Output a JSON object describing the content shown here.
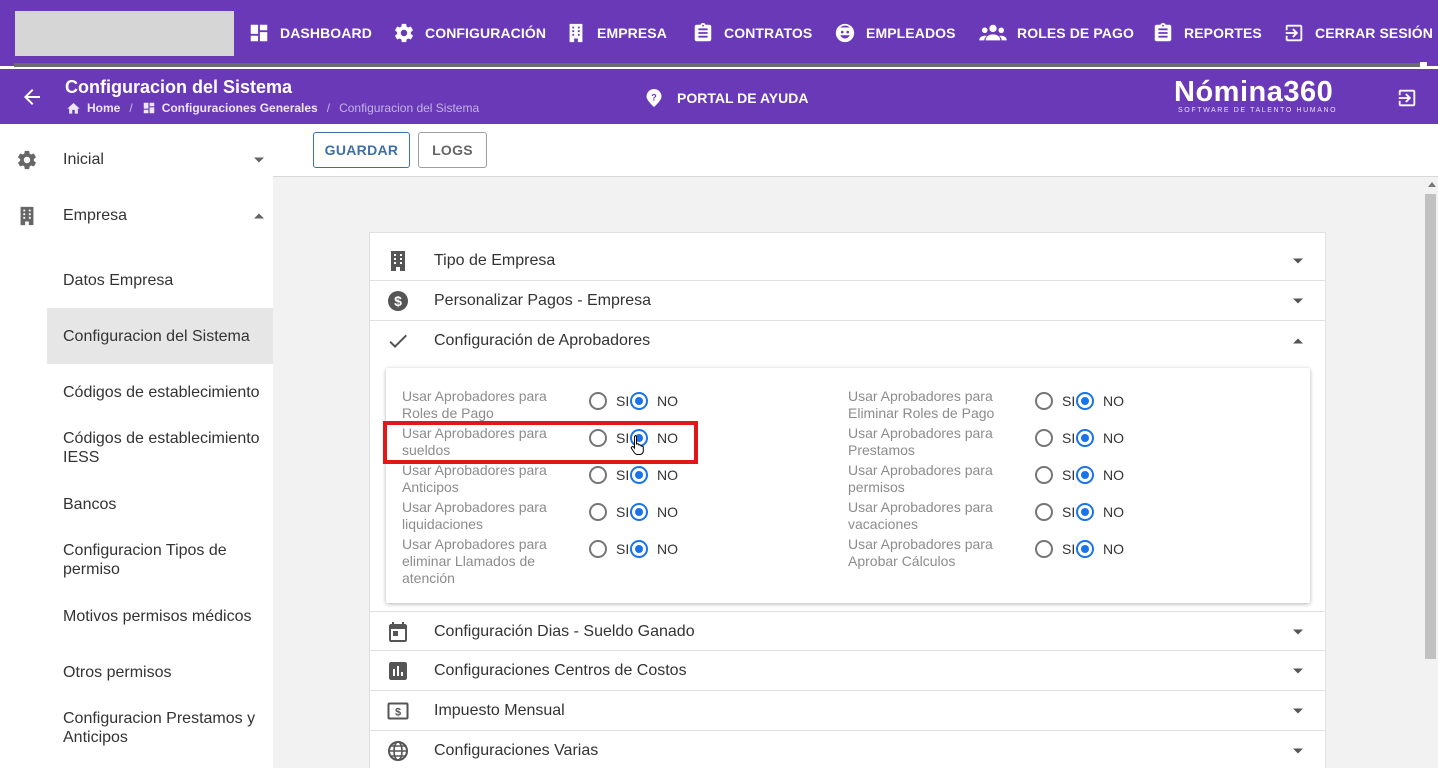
{
  "topnav": {
    "items": [
      {
        "label": "DASHBOARD",
        "icon": "dashboard-icon"
      },
      {
        "label": "CONFIGURACIÓN",
        "icon": "gear-icon"
      },
      {
        "label": "EMPRESA",
        "icon": "building-icon"
      },
      {
        "label": "CONTRATOS",
        "icon": "clipboard-icon"
      },
      {
        "label": "EMPLEADOS",
        "icon": "face-icon"
      },
      {
        "label": "ROLES DE PAGO",
        "icon": "people-icon"
      },
      {
        "label": "REPORTES",
        "icon": "clipboard-list-icon"
      },
      {
        "label": "CERRAR SESIÓN",
        "icon": "logout-icon"
      }
    ],
    "accent_color": "#6a39b8"
  },
  "header": {
    "title": "Configuracion del Sistema",
    "breadcrumb": {
      "home": "Home",
      "section": "Configuraciones Generales",
      "current": "Configuracion del Sistema",
      "separator": "/"
    },
    "help": "PORTAL DE AYUDA",
    "brand_name": "Nómina360",
    "brand_tagline": "SOFTWARE DE TALENTO HUMANO"
  },
  "sidebar": {
    "groups": [
      {
        "label": "Inicial",
        "icon": "gear-icon",
        "expanded": false
      },
      {
        "label": "Empresa",
        "icon": "building-icon",
        "expanded": true
      }
    ],
    "items": [
      {
        "label": "Datos Empresa",
        "active": false
      },
      {
        "label": "Configuracion del Sistema",
        "active": true
      },
      {
        "label": "Códigos de establecimiento",
        "active": false
      },
      {
        "label": "Códigos de establecimiento IESS",
        "active": false
      },
      {
        "label": "Bancos",
        "active": false
      },
      {
        "label": "Configuracion Tipos de permiso",
        "active": false
      },
      {
        "label": "Motivos permisos médicos",
        "active": false
      },
      {
        "label": "Otros permisos",
        "active": false
      },
      {
        "label": "Configuracion Prestamos y Anticipos",
        "active": false
      }
    ]
  },
  "toolbar": {
    "save_label": "GUARDAR",
    "logs_label": "LOGS"
  },
  "accordion": {
    "sections": [
      {
        "label": "Tipo de Empresa",
        "icon": "building-icon",
        "expanded": false
      },
      {
        "label": "Personalizar Pagos - Empresa",
        "icon": "dollar-circle-icon",
        "expanded": false
      },
      {
        "label": "Configuración de Aprobadores",
        "icon": "check-icon",
        "expanded": true
      },
      {
        "label": "Configuración Dias - Sueldo Ganado",
        "icon": "calendar-icon",
        "expanded": false
      },
      {
        "label": "Configuraciones Centros de Costos",
        "icon": "bar-chart-icon",
        "expanded": false
      },
      {
        "label": "Impuesto Mensual",
        "icon": "money-icon",
        "expanded": false
      },
      {
        "label": "Configuraciones Varias",
        "icon": "globe-icon",
        "expanded": false
      }
    ],
    "options": {
      "yes_label": "SI",
      "no_label": "NO",
      "left": [
        {
          "label": "Usar Aprobadores para Roles de Pago",
          "value": "NO"
        },
        {
          "label": "Usar Aprobadores para sueldos",
          "value": "NO"
        },
        {
          "label": "Usar Aprobadores para Anticipos",
          "value": "NO"
        },
        {
          "label": "Usar Aprobadores para liquidaciones",
          "value": "NO"
        },
        {
          "label": "Usar Aprobadores para eliminar Llamados de atención",
          "value": "NO"
        }
      ],
      "right": [
        {
          "label": "Usar Aprobadores para Eliminar Roles de Pago",
          "value": "NO"
        },
        {
          "label": "Usar Aprobadores para Prestamos",
          "value": "NO"
        },
        {
          "label": "Usar Aprobadores para permisos",
          "value": "NO"
        },
        {
          "label": "Usar Aprobadores para vacaciones",
          "value": "NO"
        },
        {
          "label": "Usar Aprobadores para Aprobar Cálculos",
          "value": "NO"
        }
      ]
    }
  }
}
